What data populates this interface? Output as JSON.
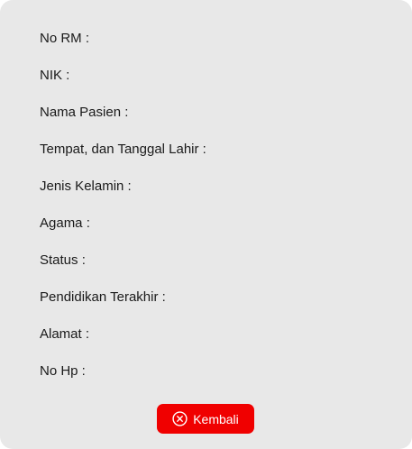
{
  "fields": [
    {
      "label": "No RM :"
    },
    {
      "label": "NIK :"
    },
    {
      "label": "Nama Pasien :"
    },
    {
      "label": "Tempat, dan Tanggal Lahir :"
    },
    {
      "label": "Jenis Kelamin :"
    },
    {
      "label": "Agama :"
    },
    {
      "label": "Status :"
    },
    {
      "label": "Pendidikan Terakhir :"
    },
    {
      "label": "Alamat :"
    },
    {
      "label": "No Hp :"
    }
  ],
  "back_button": {
    "label": "Kembali",
    "icon": "circle-x-icon",
    "color": "#f00000"
  },
  "colors": {
    "card_background": "#e8e8e8",
    "text": "#1a1a1a"
  }
}
